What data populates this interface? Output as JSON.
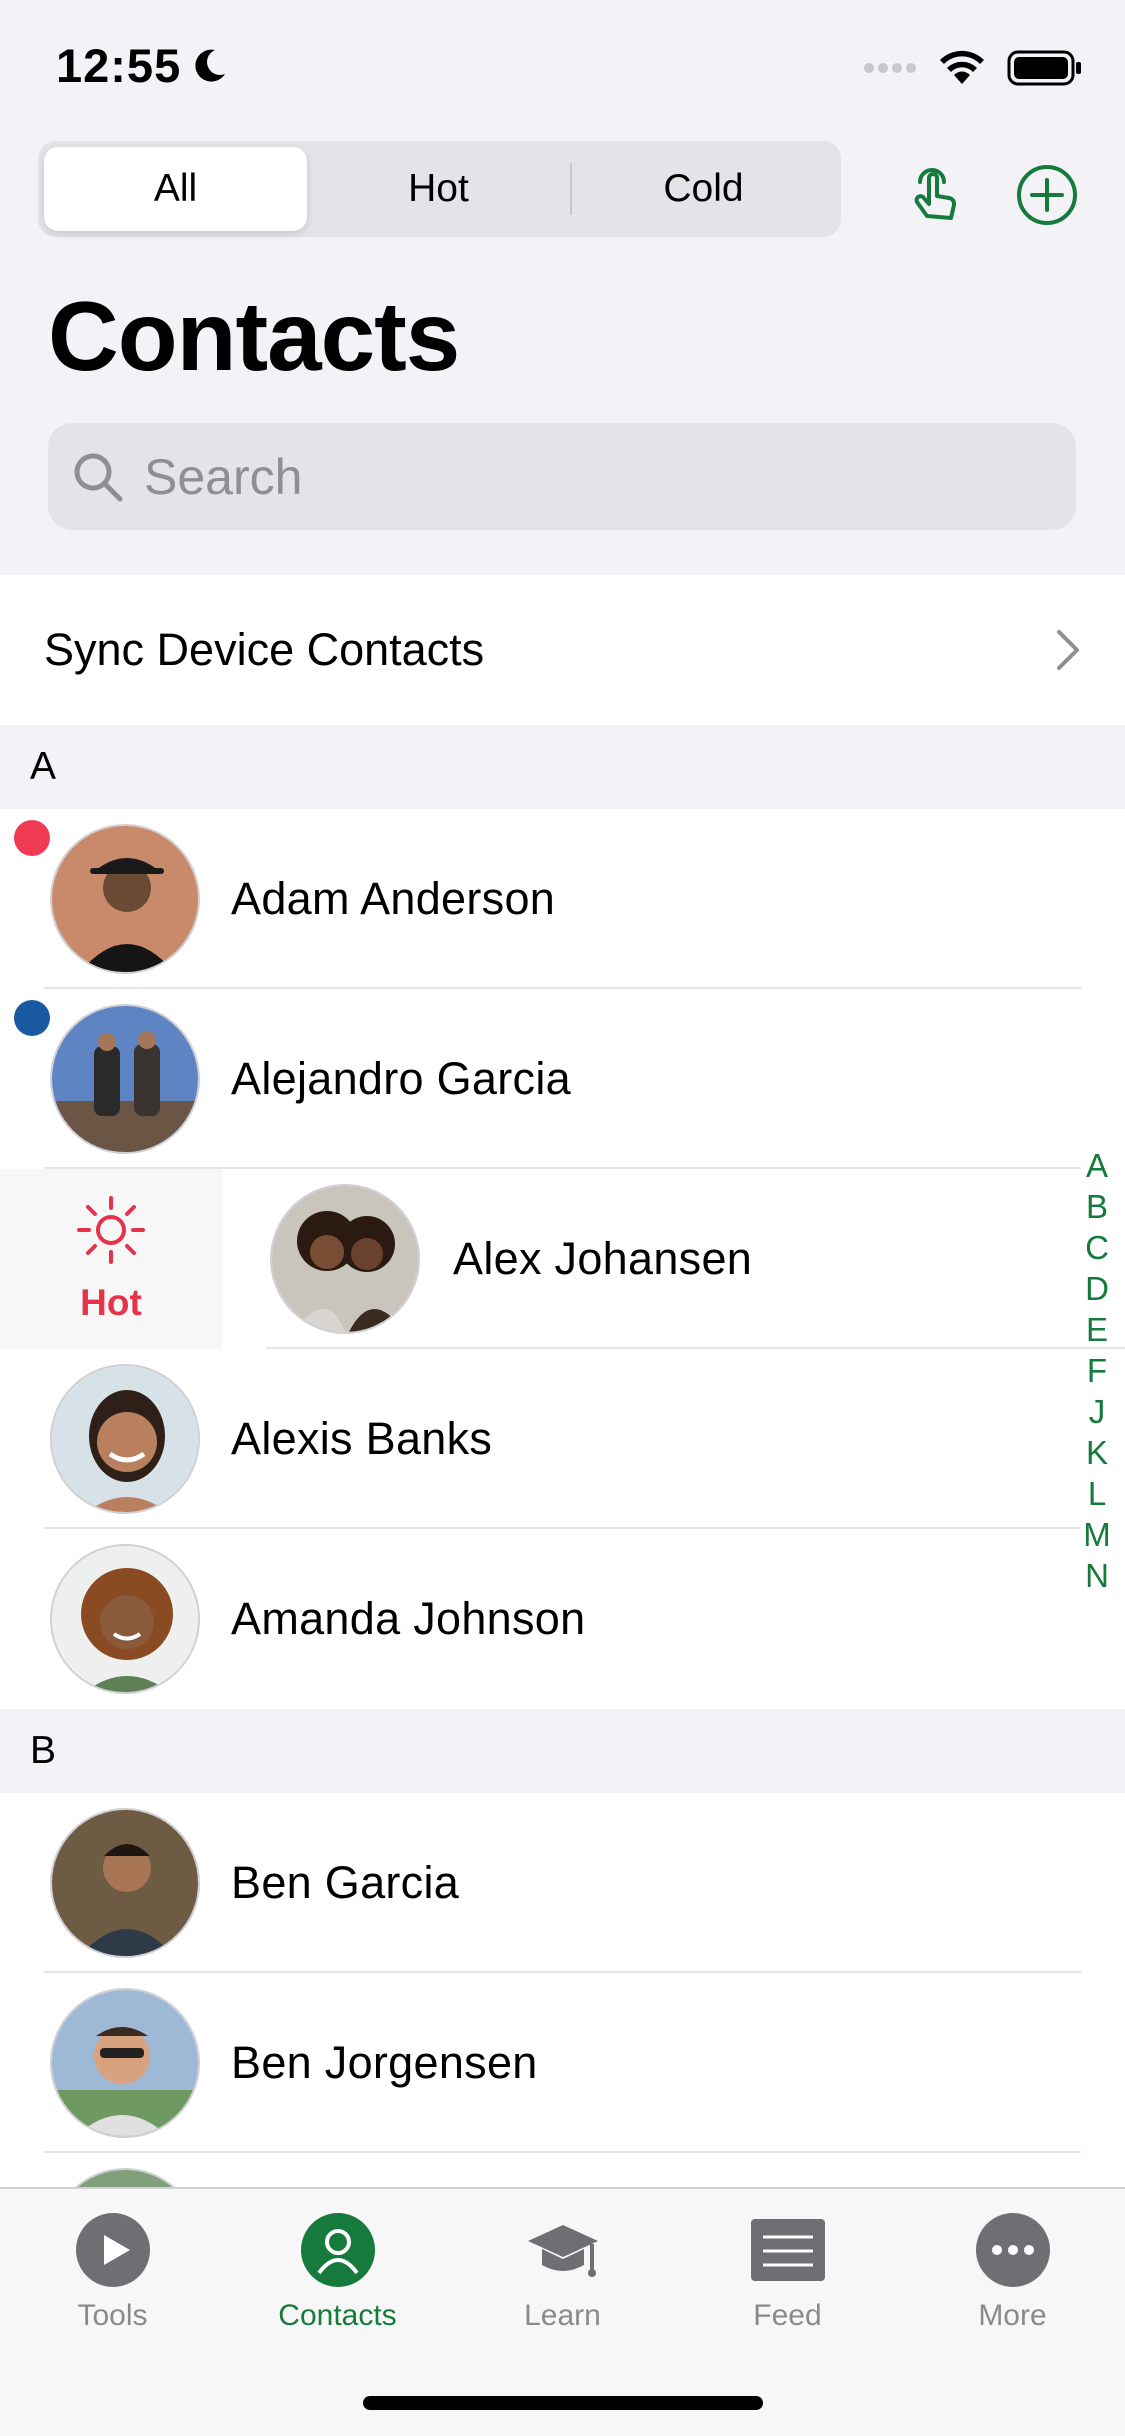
{
  "status_bar": {
    "time": "12:55"
  },
  "filter_tabs": [
    {
      "label": "All",
      "active": true
    },
    {
      "label": "Hot",
      "active": false
    },
    {
      "label": "Cold",
      "active": false
    }
  ],
  "page_title": "Contacts",
  "search": {
    "placeholder": "Search"
  },
  "sync_row": {
    "label": "Sync Device Contacts"
  },
  "sections": [
    {
      "letter": "A",
      "contacts": [
        {
          "name": "Adam Anderson",
          "status_color": "#ef3b52"
        },
        {
          "name": "Alejandro Garcia",
          "status_color": "#1a5aa3"
        },
        {
          "name": "Alex Johansen",
          "swipe_action": "Hot"
        },
        {
          "name": "Alexis Banks"
        },
        {
          "name": "Amanda Johnson"
        }
      ]
    },
    {
      "letter": "B",
      "contacts": [
        {
          "name": "Ben Garcia"
        },
        {
          "name": "Ben Jorgensen"
        }
      ]
    }
  ],
  "index_letters": [
    "A",
    "B",
    "C",
    "D",
    "E",
    "F",
    "J",
    "K",
    "L",
    "M",
    "N"
  ],
  "tab_bar": [
    {
      "label": "Tools",
      "icon": "play-icon"
    },
    {
      "label": "Contacts",
      "icon": "person-icon",
      "active": true
    },
    {
      "label": "Learn",
      "icon": "graduation-cap-icon"
    },
    {
      "label": "Feed",
      "icon": "feed-icon"
    },
    {
      "label": "More",
      "icon": "more-dots-icon"
    }
  ],
  "colors": {
    "accent_green": "#167a3c",
    "hot_red": "#e5334b",
    "dot_red": "#ef3b52",
    "dot_blue": "#1a5aa3"
  }
}
